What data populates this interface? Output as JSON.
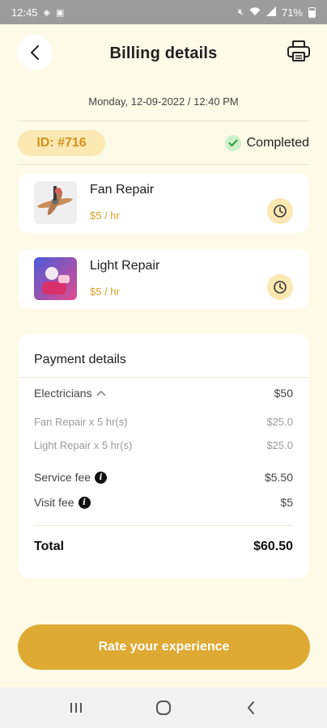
{
  "status_bar": {
    "time": "12:45",
    "battery": "71%"
  },
  "header": {
    "title": "Billing details"
  },
  "datetime": "Monday, 12-09-2022 / 12:40 PM",
  "order": {
    "id": "ID: #716",
    "status": "Completed"
  },
  "services": [
    {
      "name": "Fan Repair",
      "rate": "$5 / hr"
    },
    {
      "name": "Light Repair",
      "rate": "$5 / hr"
    }
  ],
  "payment": {
    "title": "Payment details",
    "category": {
      "label": "Electricians",
      "value": "$50"
    },
    "lines": [
      {
        "label": "Fan Repair x  5 hr(s)",
        "value": "$25.0"
      },
      {
        "label": "Light Repair x  5 hr(s)",
        "value": "$25.0"
      }
    ],
    "service_fee": {
      "label": "Service fee",
      "value": "$5.50"
    },
    "visit_fee": {
      "label": "Visit fee",
      "value": "$5"
    },
    "total": {
      "label": "Total",
      "value": "$60.50"
    }
  },
  "cta": {
    "label": "Rate your experience"
  },
  "colors": {
    "accent": "#deaa33",
    "background": "#fdfbe7",
    "badge_bg": "#fbe8b3",
    "badge_text": "#d4921b"
  }
}
